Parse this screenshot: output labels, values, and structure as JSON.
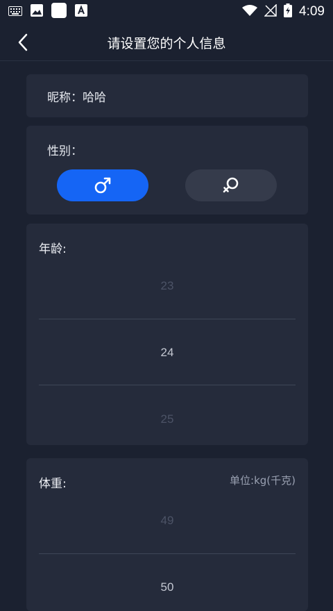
{
  "status_bar": {
    "time": "4:09",
    "left_icons": [
      "keyboard-icon",
      "image-icon",
      "white-square-icon",
      "text-a-icon"
    ],
    "right_icons": [
      "wifi-icon",
      "no-signal-icon",
      "battery-charging-icon"
    ]
  },
  "app_bar": {
    "title": "请设置您的个人信息",
    "back_icon": "chevron-left-icon"
  },
  "nickname": {
    "text": "昵称：哈哈"
  },
  "gender": {
    "label": "性别：",
    "selected": "male",
    "male_icon": "male-symbol-icon",
    "female_icon": "female-symbol-icon",
    "colors": {
      "selected": "#1565f5",
      "unselected": "#353b4b"
    }
  },
  "age": {
    "label": "年龄:",
    "above": "23",
    "selected": "24",
    "below": "25"
  },
  "weight": {
    "label": "体重:",
    "unit": "单位:kg(千克)",
    "above": "49",
    "selected": "50"
  }
}
